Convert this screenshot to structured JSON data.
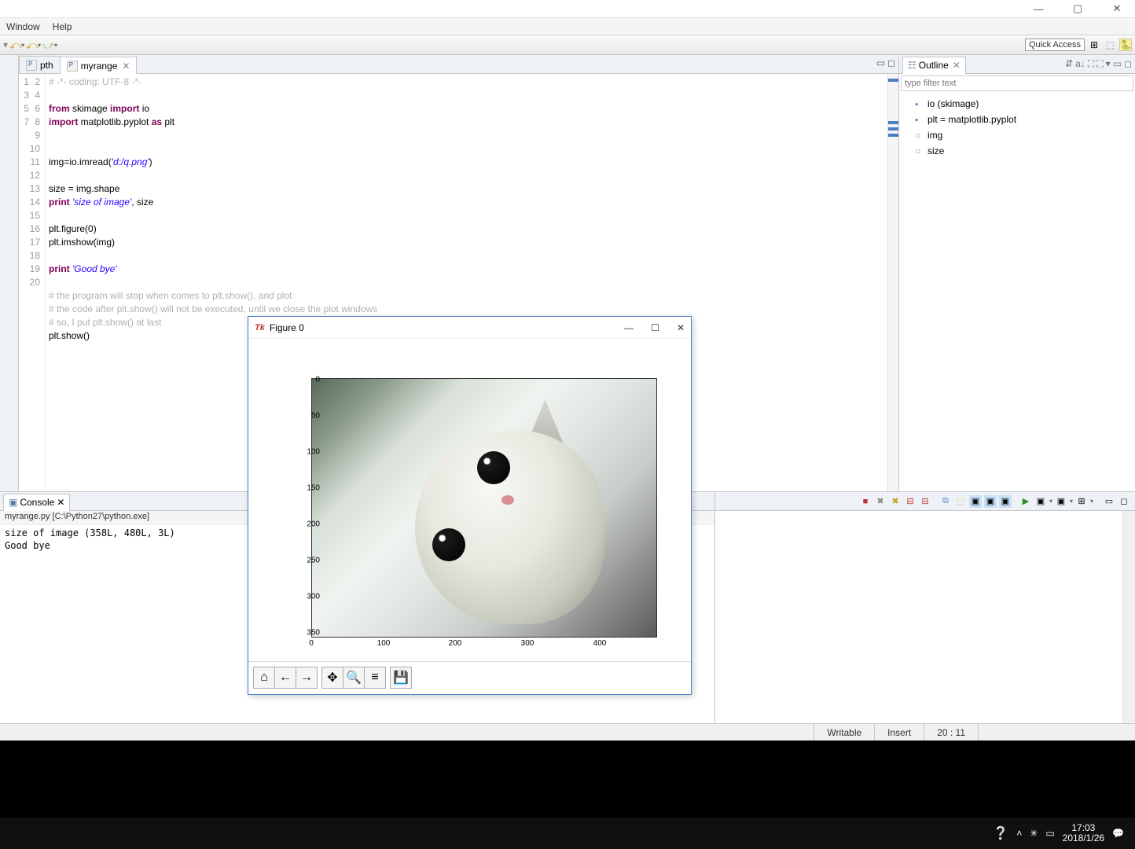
{
  "window_controls": {
    "min": "—",
    "max": "▢",
    "close": "✕"
  },
  "menubar": {
    "window": "Window",
    "help": "Help"
  },
  "toolbar": {
    "quick_access": "Quick Access"
  },
  "tabs": {
    "t1": "pth",
    "t2": "myrange"
  },
  "code_lines": {
    "l1": "# -*- coding: UTF-8 -*-",
    "l3a": "from",
    "l3b": " skimage ",
    "l3c": "import",
    "l3d": " io",
    "l4a": "import",
    "l4b": " matplotlib.pyplot ",
    "l4c": "as",
    "l4d": " plt",
    "l7a": "img=io.imread(",
    "l7b": "'d:/q.png'",
    "l7c": ")",
    "l9": "size = img.shape",
    "l10a": "print",
    "l10b": " ",
    "l10c": "'size of image'",
    "l10d": ", size",
    "l12": "plt.figure(0)",
    "l13": "plt.imshow(img)",
    "l15a": "print",
    "l15b": " ",
    "l15c": "'Good bye'",
    "l17": "# the program will stop when comes to plt.show(), and plot",
    "l18": "# the code after plt.show() will not be executed, until we close the plot windows",
    "l19": "# so, I put plt.show() at last",
    "l20": "plt.show()"
  },
  "gutter": [
    "1",
    "2",
    "3",
    "4",
    "5",
    "6",
    "7",
    "8",
    "9",
    "10",
    "11",
    "12",
    "13",
    "14",
    "15",
    "16",
    "17",
    "18",
    "19",
    "20"
  ],
  "outline": {
    "title": "Outline",
    "filter_placeholder": "type filter text",
    "items": [
      "io (skimage)",
      "plt = matplotlib.pyplot",
      "img",
      "size"
    ]
  },
  "console": {
    "tab": "Console",
    "subtitle": "myrange.py [C:\\Python27\\python.exe]",
    "out": "size of image (358L, 480L, 3L)\nGood bye"
  },
  "status": {
    "writable": "Writable",
    "insert": "Insert",
    "pos": "20 : 11"
  },
  "figure": {
    "tk": "Tk",
    "title": "Figure 0",
    "yticks": [
      "0",
      "50",
      "100",
      "150",
      "200",
      "250",
      "300",
      "350"
    ],
    "xticks": [
      "0",
      "100",
      "200",
      "300",
      "400"
    ]
  },
  "chart_data": {
    "type": "image-plot",
    "title": "Figure 0",
    "image_shape": [
      358,
      480,
      3
    ],
    "x_axis": {
      "range": [
        0,
        480
      ],
      "ticks": [
        0,
        100,
        200,
        300,
        400
      ]
    },
    "y_axis": {
      "range": [
        0,
        358
      ],
      "ticks": [
        0,
        50,
        100,
        150,
        200,
        250,
        300,
        350
      ],
      "inverted": true
    }
  },
  "taskbar": {
    "time": "17:03",
    "date": "2018/1/26"
  }
}
